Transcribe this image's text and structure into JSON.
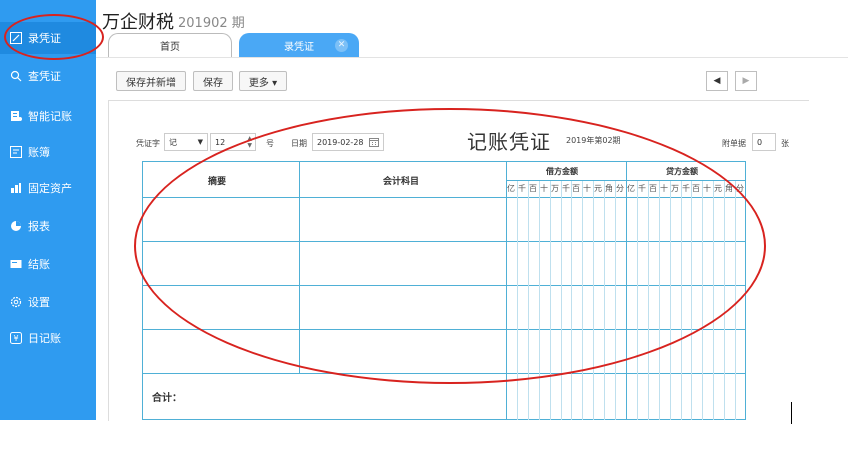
{
  "app": {
    "title": "万企财税",
    "period": "201902 期"
  },
  "sidebar": {
    "items": [
      {
        "label": "录凭证",
        "icon": "edit-icon",
        "active": true
      },
      {
        "label": "查凭证",
        "icon": "search-icon"
      },
      {
        "label": "智能记账",
        "icon": "ledger-icon"
      },
      {
        "label": "账簿",
        "icon": "book-icon"
      },
      {
        "label": "固定资产",
        "icon": "assets-icon"
      },
      {
        "label": "报表",
        "icon": "pie-icon"
      },
      {
        "label": "结账",
        "icon": "close-account-icon"
      },
      {
        "label": "设置",
        "icon": "gear-icon"
      },
      {
        "label": "日记账",
        "icon": "journal-icon"
      }
    ]
  },
  "tabs": [
    {
      "label": "首页"
    },
    {
      "label": "录凭证",
      "active": true
    }
  ],
  "toolbar": {
    "save_new": "保存并新增",
    "save": "保存",
    "more": "更多 ▾"
  },
  "voucher": {
    "word_label": "凭证字",
    "word_value": "记",
    "number_value": "12",
    "number_suffix": "号",
    "date_label": "日期",
    "date_value": "2019-02-28",
    "title": "记账凭证",
    "period": "2019年第02期",
    "attach_label": "附单据",
    "attach_value": "0",
    "attach_unit": "张"
  },
  "table": {
    "col_summary": "摘要",
    "col_account": "会计科目",
    "col_debit": "借方金额",
    "col_credit": "贷方金额",
    "digits": [
      "亿",
      "千",
      "百",
      "十",
      "万",
      "千",
      "百",
      "十",
      "元",
      "角",
      "分"
    ],
    "total_label": "合计："
  },
  "colors": {
    "sidebar": "#2f9bf0",
    "accent": "#4aa8f5",
    "grid": "#4fb0d6",
    "annotation": "#d8231f"
  }
}
